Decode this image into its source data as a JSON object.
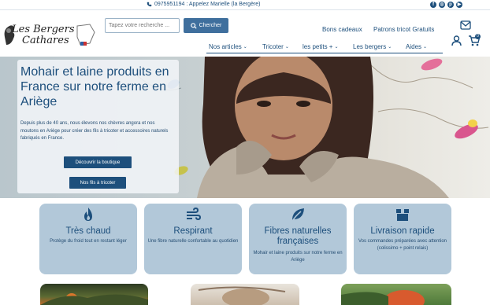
{
  "topbar": {
    "phone": "0975951194 : Appelez Marielle (la Bergère)",
    "socials": [
      "facebook-icon",
      "instagram-icon",
      "pinterest-icon",
      "youtube-icon"
    ]
  },
  "header": {
    "logo_line1": "Les Bergers",
    "logo_line2": "Cathares",
    "search_placeholder": "Tapez votre recherche ...",
    "search_button": "Chercher",
    "link_gift": "Bons cadeaux",
    "link_patterns": "Patrons tricot Gratuits",
    "cart_count": "0"
  },
  "nav": {
    "items": [
      {
        "label": "Nos articles"
      },
      {
        "label": "Tricoter"
      },
      {
        "label": "les petits +"
      },
      {
        "label": "Les bergers"
      },
      {
        "label": "Aides"
      }
    ]
  },
  "hero": {
    "title": "Mohair et laine produits en France sur notre ferme en Ariège",
    "text": "Depuis plus de 40 ans, nous élevons nos chèvres angora et nos moutons en Ariège pour créer des fils à tricoter et accessoires naturels fabriqués en France.",
    "button_shop": "Découvrir la boutique",
    "button_yarns": "Nos fils à tricoter"
  },
  "features": [
    {
      "title": "Très chaud",
      "text": "Protège du froid tout en restant léger",
      "icon": "flame-icon"
    },
    {
      "title": "Respirant",
      "text": "Une fibre naturelle confortable au quotidien",
      "icon": "wind-icon"
    },
    {
      "title": "Fibres naturelles françaises",
      "text": "Mohair et laine produits sur notre ferme en Ariège",
      "icon": "leaf-icon"
    },
    {
      "title": "Livraison rapide",
      "text": "Vos commandes préparées avec attention (colissimo + point relais)",
      "icon": "box-icon"
    }
  ],
  "colors": {
    "brand": "#1d4f7c",
    "feature_bg": "#b2c8d9",
    "button": "#3f6f9d"
  }
}
